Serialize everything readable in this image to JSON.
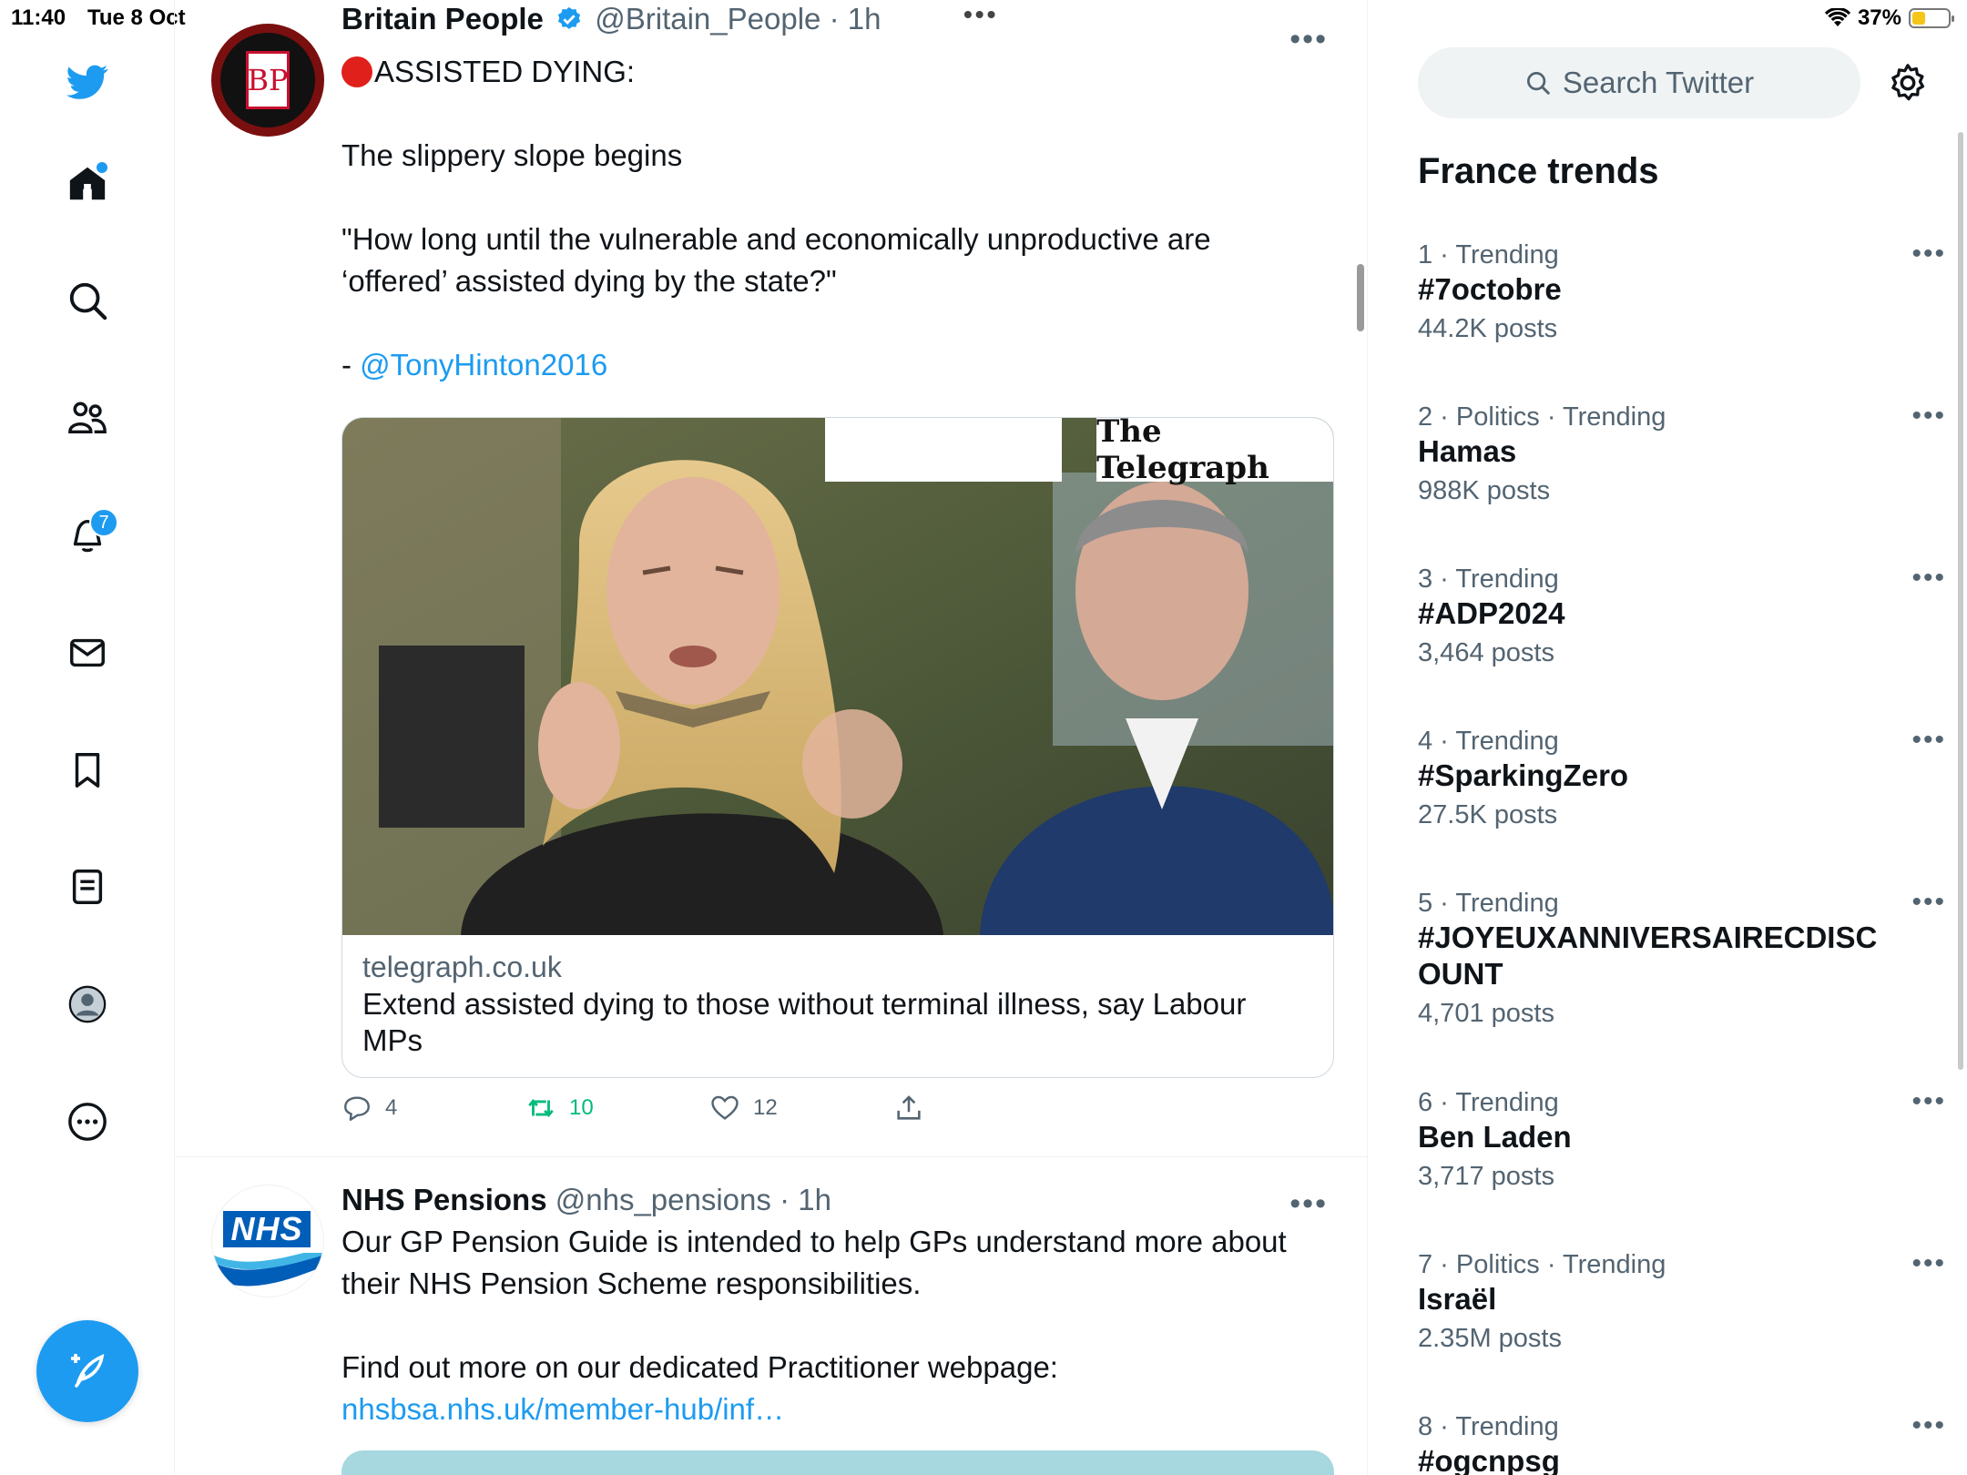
{
  "status_bar": {
    "time": "11:40",
    "date": "Tue 8 Oct",
    "battery": "37%",
    "battery_level": 0.37,
    "multitask": "•••"
  },
  "nav": {
    "items": [
      {
        "icon": "twitter-bird-icon"
      },
      {
        "icon": "home-icon",
        "unread_dot": true
      },
      {
        "icon": "search-icon"
      },
      {
        "icon": "communities-icon"
      },
      {
        "icon": "notifications-icon",
        "badge": "7"
      },
      {
        "icon": "messages-icon"
      },
      {
        "icon": "bookmarks-icon"
      },
      {
        "icon": "lists-icon"
      },
      {
        "icon": "profile-icon"
      },
      {
        "icon": "more-icon"
      }
    ],
    "compose_icon": "compose-feather-icon"
  },
  "feed": {
    "tweets": [
      {
        "name": "Britain People",
        "handle": "@Britain_People",
        "time": "· 1h",
        "avatar_text": "BP",
        "text_1": "ASSISTED DYING:",
        "text_2": "The slippery slope begins",
        "text_3": "\"How long until the vulnerable and economically unproductive are ‘offered’ assisted dying by the state?\"",
        "text_4_prefix": "- ",
        "mention": "@TonyHinton2016",
        "card": {
          "badge": "The Telegraph",
          "domain": "telegraph.co.uk",
          "title": "Extend assisted dying to those without terminal illness, say Labour MPs"
        },
        "replies": "4",
        "retweets": "10",
        "likes": "12",
        "more": "•••"
      },
      {
        "name": "NHS Pensions",
        "handle": "@nhs_pensions",
        "time": "· 1h",
        "avatar_text": "NHS",
        "text_1": "Our GP Pension Guide is intended to help GPs understand more about their NHS Pension Scheme responsibilities.",
        "text_2": "Find out more on our dedicated Practitioner webpage:",
        "link": "nhsbsa.nhs.uk/member-hub/inf…",
        "more": "•••"
      }
    ]
  },
  "right": {
    "search_placeholder": "Search Twitter",
    "trends_title": "France trends",
    "trends": [
      {
        "meta": "1 · Trending",
        "name": "#7octobre",
        "posts": "44.2K posts"
      },
      {
        "meta": "2 · Politics · Trending",
        "name": "Hamas",
        "posts": "988K posts"
      },
      {
        "meta": "3 · Trending",
        "name": "#ADP2024",
        "posts": "3,464 posts"
      },
      {
        "meta": "4 · Trending",
        "name": "#SparkingZero",
        "posts": "27.5K posts"
      },
      {
        "meta": "5 · Trending",
        "name": "#JOYEUXANNIVERSAIRECDISCOUNT",
        "posts": "4,701 posts"
      },
      {
        "meta": "6 · Trending",
        "name": "Ben Laden",
        "posts": "3,717 posts"
      },
      {
        "meta": "7 · Politics · Trending",
        "name": "Israël",
        "posts": "2.35M posts"
      },
      {
        "meta": "8 · Trending",
        "name": "#ogcnpsg",
        "posts": ""
      }
    ],
    "trend_more": "•••"
  },
  "colors": {
    "accent": "#1d9bf0",
    "retweet": "#00ba7c",
    "secondary_text": "#536471",
    "border": "#eff3f4"
  }
}
